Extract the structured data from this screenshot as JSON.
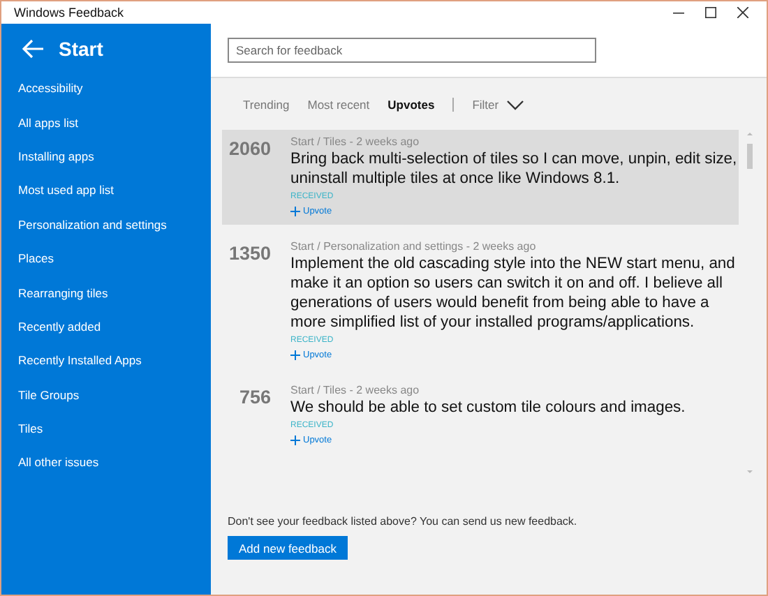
{
  "window": {
    "title": "Windows Feedback"
  },
  "sidebar": {
    "title": "Start",
    "items": [
      {
        "label": "Accessibility"
      },
      {
        "label": "All apps list"
      },
      {
        "label": "Installing apps"
      },
      {
        "label": "Most used app list"
      },
      {
        "label": "Personalization and settings"
      },
      {
        "label": "Places"
      },
      {
        "label": "Rearranging tiles"
      },
      {
        "label": "Recently added"
      },
      {
        "label": "Recently Installed Apps"
      },
      {
        "label": "Tile Groups"
      },
      {
        "label": "Tiles"
      },
      {
        "label": "All other issues"
      }
    ]
  },
  "search": {
    "placeholder": "Search for feedback"
  },
  "tabs": [
    {
      "label": "Trending",
      "selected": false
    },
    {
      "label": "Most recent",
      "selected": false
    },
    {
      "label": "Upvotes",
      "selected": true
    }
  ],
  "filter": {
    "label": "Filter"
  },
  "feedback": [
    {
      "votes": "2060",
      "meta": "Start / Tiles - 2 weeks ago",
      "text": "Bring back multi-selection of tiles so I can move, unpin, edit size, uninstall multiple tiles at once like Windows 8.1.",
      "status": "RECEIVED",
      "upvote": "Upvote",
      "selected": true
    },
    {
      "votes": "1350",
      "meta": "Start / Personalization and settings - 2 weeks ago",
      "text": "Implement the old cascading style into the NEW start menu, and make it an option so users can switch it on and off. I believe all generations of users would benefit from being able to have a more simplified list of your installed programs/applications.",
      "status": "RECEIVED",
      "upvote": "Upvote",
      "selected": false
    },
    {
      "votes": "756",
      "meta": "Start / Tiles - 2 weeks ago",
      "text": "We should be able to set custom tile colours and images.",
      "status": "RECEIVED",
      "upvote": "Upvote",
      "selected": false
    }
  ],
  "footer": {
    "text": "Don't see your feedback listed above? You can send us new feedback.",
    "button": "Add new feedback"
  }
}
